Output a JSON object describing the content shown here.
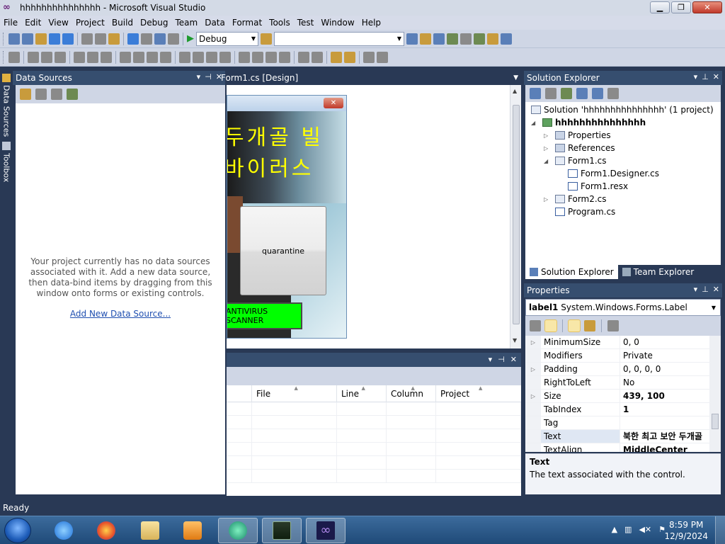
{
  "window": {
    "title": "hhhhhhhhhhhhhhh - Microsoft Visual Studio"
  },
  "menu": [
    "File",
    "Edit",
    "View",
    "Project",
    "Build",
    "Debug",
    "Team",
    "Data",
    "Format",
    "Tools",
    "Test",
    "Window",
    "Help"
  ],
  "toolbar": {
    "config": "Debug",
    "platform": ""
  },
  "side_tabs": {
    "data_sources": "Data Sources",
    "toolbox": "Toolbox"
  },
  "data_sources": {
    "title": "Data Sources",
    "message": "Your project currently has no data sources associated with it. Add a new data source, then data-bind items by dragging from this window onto forms or existing controls.",
    "link": "Add New Data Source..."
  },
  "designer": {
    "tab": "Form1.cs [Design]",
    "form_text_line1": "두개골 빌",
    "form_text_line2": "바이러스",
    "quarantine_label": "quarantine",
    "scanner_label": "ANTIVIRUS SCANNER"
  },
  "error_list": {
    "columns": [
      "",
      "File",
      "Line",
      "Column",
      "Project"
    ]
  },
  "solution_explorer": {
    "title": "Solution Explorer",
    "solution": "Solution 'hhhhhhhhhhhhhhh' (1 project)",
    "project": "hhhhhhhhhhhhhhh",
    "items": {
      "properties": "Properties",
      "references": "References",
      "form1": "Form1.cs",
      "form1_designer": "Form1.Designer.cs",
      "form1_resx": "Form1.resx",
      "form2": "Form2.cs",
      "program": "Program.cs"
    },
    "tab_solution": "Solution Explorer",
    "tab_team": "Team Explorer"
  },
  "properties": {
    "title": "Properties",
    "object": "label1",
    "object_type": "System.Windows.Forms.Label",
    "rows": [
      {
        "name": "MinimumSize",
        "value": "0, 0"
      },
      {
        "name": "Modifiers",
        "value": "Private"
      },
      {
        "name": "Padding",
        "value": "0, 0, 0, 0"
      },
      {
        "name": "RightToLeft",
        "value": "No"
      },
      {
        "name": "Size",
        "value": "439, 100"
      },
      {
        "name": "TabIndex",
        "value": "1"
      },
      {
        "name": "Tag",
        "value": ""
      },
      {
        "name": "Text",
        "value": "북한 최고 보안 두개골"
      },
      {
        "name": "TextAlign",
        "value": "MiddleCenter"
      }
    ],
    "desc_title": "Text",
    "desc_text": "The text associated with the control."
  },
  "status": {
    "text": "Ready"
  },
  "taskbar": {
    "time": "8:59 PM",
    "date": "12/9/2024"
  }
}
